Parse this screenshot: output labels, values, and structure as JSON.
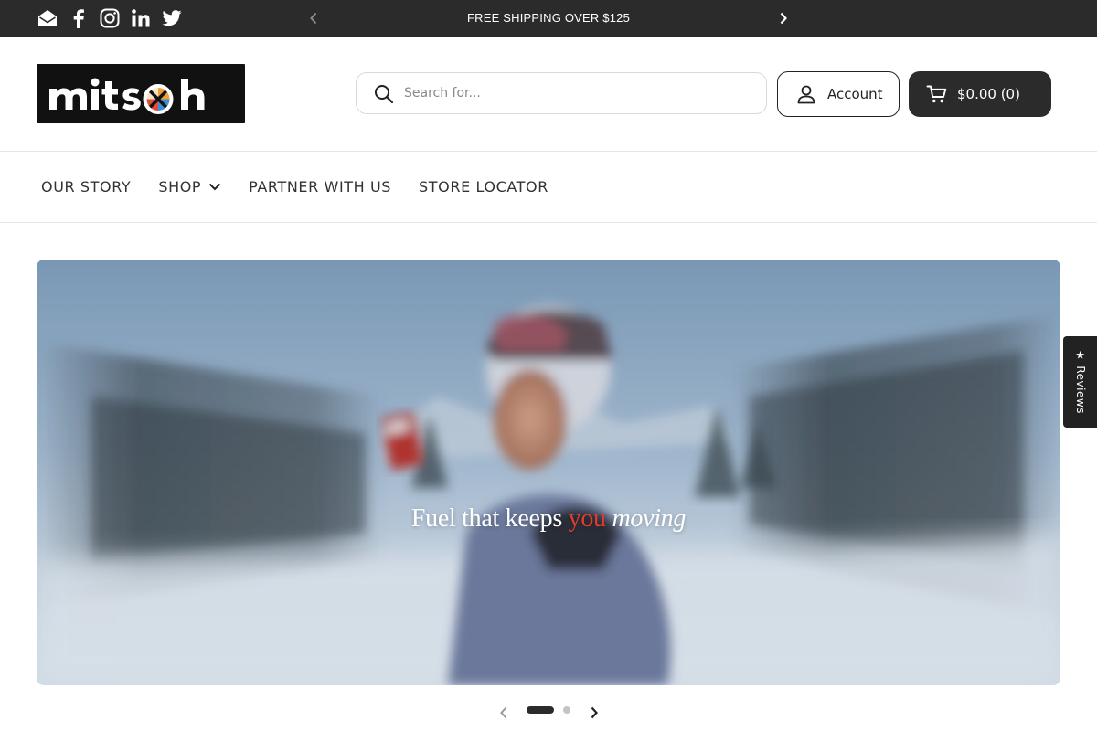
{
  "announcement": {
    "text": "FREE SHIPPING OVER $125"
  },
  "social_icons": [
    "email-icon",
    "facebook-icon",
    "instagram-icon",
    "linkedin-icon",
    "twitter-icon"
  ],
  "header": {
    "logo_text": "mitsoh",
    "search_placeholder": "Search for...",
    "account_label": "Account",
    "cart_label": "$0.00 (0)"
  },
  "nav": {
    "items": [
      {
        "label": "OUR STORY",
        "has_dropdown": false
      },
      {
        "label": "SHOP",
        "has_dropdown": true
      },
      {
        "label": "PARTNER WITH US",
        "has_dropdown": false
      },
      {
        "label": "STORE LOCATOR",
        "has_dropdown": false
      }
    ]
  },
  "hero": {
    "headline_part1": "Fuel that keeps",
    "headline_accent": "you",
    "headline_italic": "moving",
    "slide_count": 2,
    "active_slide": 1
  },
  "reviews_tab": {
    "label": "Reviews",
    "star": "★"
  },
  "colors": {
    "topbar": "#2b2b2b",
    "accent_red": "#e23b2e",
    "logo_orange": "#f0a030",
    "logo_blue": "#3e8ed8",
    "logo_red": "#e24a3a",
    "logo_cream": "#f3e6c8"
  }
}
